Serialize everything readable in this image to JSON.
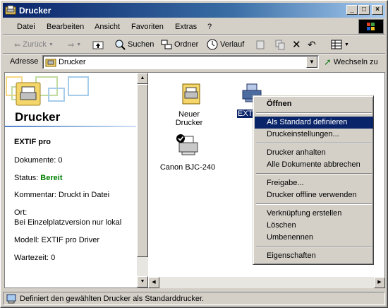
{
  "window": {
    "title": "Drucker"
  },
  "menubar": {
    "items": [
      "Datei",
      "Bearbeiten",
      "Ansicht",
      "Favoriten",
      "Extras",
      "?"
    ]
  },
  "toolbar": {
    "back": "Zurück",
    "search": "Suchen",
    "folders": "Ordner",
    "history": "Verlauf"
  },
  "address": {
    "label": "Adresse",
    "value": "Drucker",
    "go": "Wechseln zu"
  },
  "left_panel": {
    "heading": "Drucker",
    "printer_name": "EXTIF pro",
    "documents": "Dokumente: 0",
    "status_label": "Status: ",
    "status_value": "Bereit",
    "comment": "Kommentar: Druckt in Datei",
    "location_label": "Ort:",
    "location_value": "Bei Einzelplatzversion nur lokal",
    "model": "Modell: EXTIF pro Driver",
    "wait": "Wartezeit: 0"
  },
  "icons": [
    {
      "label": "Neuer Drucker"
    },
    {
      "label": "EXTI"
    },
    {
      "label": "Canon BJC-240"
    }
  ],
  "context_menu": {
    "items": [
      "Öffnen",
      "Als Standard definieren",
      "Druckeinstellungen...",
      "Drucker anhalten",
      "Alle Dokumente abbrechen",
      "Freigabe...",
      "Drucker offline verwenden",
      "Verknüpfung erstellen",
      "Löschen",
      "Umbenennen",
      "Eigenschaften"
    ],
    "selected_index": 1
  },
  "statusbar": {
    "text": "Definiert den gewählten Drucker als Standarddrucker."
  },
  "colors": {
    "title_active": "#0a246a",
    "status_ready": "#008000",
    "selection": "#0a246a"
  }
}
